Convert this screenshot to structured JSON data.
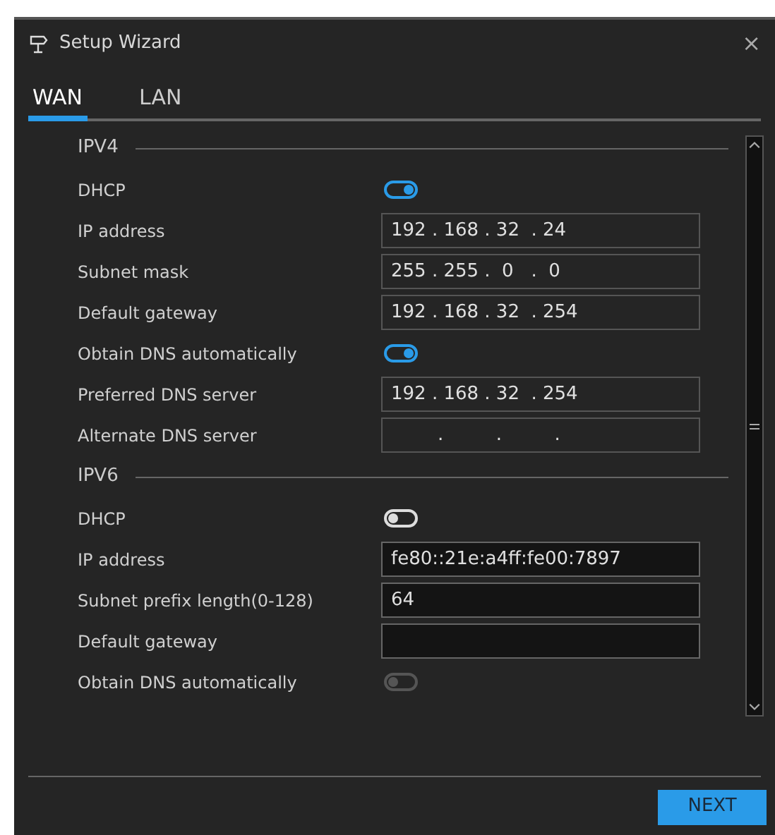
{
  "window": {
    "title": "Setup Wizard",
    "close": "×"
  },
  "tabs": [
    {
      "label": "WAN",
      "selected": true
    },
    {
      "label": "LAN",
      "selected": false
    }
  ],
  "sections": [
    {
      "title": "IPV4",
      "rows": [
        {
          "label": "DHCP",
          "kind": "toggle",
          "on": true,
          "disabled": false
        },
        {
          "label": "IP address",
          "kind": "ip_field",
          "value": "192 . 168 . 32  . 24"
        },
        {
          "label": "Subnet mask",
          "kind": "ip_field",
          "value": "255 . 255 .  0   .  0"
        },
        {
          "label": "Default gateway",
          "kind": "ip_field",
          "value": "192 . 168 . 32  . 254"
        },
        {
          "label": "Obtain DNS automatically",
          "kind": "toggle",
          "on": true,
          "disabled": false
        },
        {
          "label": "Preferred DNS server",
          "kind": "ip_field",
          "value": "192 . 168 . 32  . 254"
        },
        {
          "label": "Alternate DNS server",
          "kind": "ip_field",
          "value": "        .         .         ."
        }
      ]
    },
    {
      "title": "IPV6",
      "rows": [
        {
          "label": "DHCP",
          "kind": "toggle",
          "on": false,
          "disabled": false
        },
        {
          "label": "IP address",
          "kind": "text_field",
          "value": "fe80::21e:a4ff:fe00:7897"
        },
        {
          "label": "Subnet prefix length(0-128)",
          "kind": "text_field",
          "value": "64"
        },
        {
          "label": "Default gateway",
          "kind": "text_field"
        },
        {
          "label": "Obtain DNS automatically",
          "kind": "toggle",
          "on": false,
          "disabled": true
        }
      ]
    }
  ],
  "buttons": [
    {
      "label": "NEXT"
    }
  ]
}
